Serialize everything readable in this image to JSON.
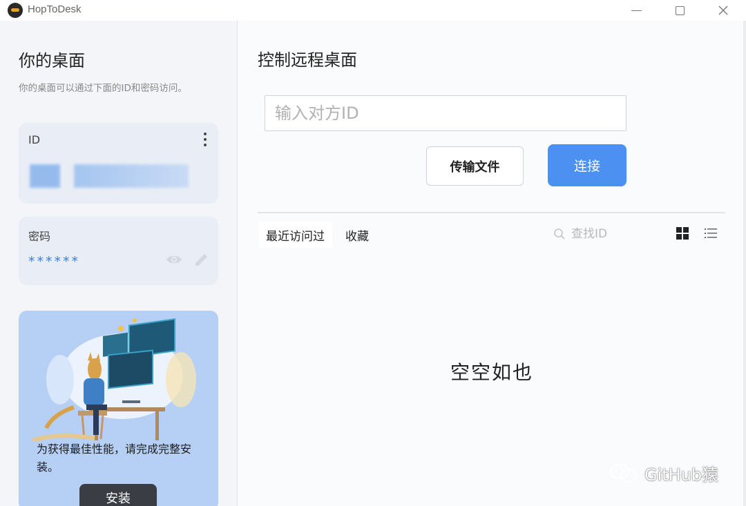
{
  "window": {
    "title": "HopToDesk",
    "minimize": "—",
    "maximize": "□",
    "close": "✕"
  },
  "left": {
    "title": "你的桌面",
    "description": "你的桌面可以通过下面的ID和密码访问。",
    "id_card": {
      "label": "ID"
    },
    "password_card": {
      "label": "密码",
      "value": "******"
    },
    "promo": {
      "text": "为获得最佳性能，请完成完整安装。",
      "install_label": "安装"
    }
  },
  "right": {
    "title": "控制远程桌面",
    "id_input_placeholder": "输入对方ID",
    "transfer_file_label": "传输文件",
    "connect_label": "连接",
    "tabs": [
      {
        "label": "最近访问过"
      },
      {
        "label": "收藏"
      }
    ],
    "search_placeholder": "查找ID",
    "empty_text": "空空如也"
  },
  "watermark": {
    "text": "GitHub猿"
  },
  "colors": {
    "accent": "#4c91f2",
    "panel": "#f3f5f8",
    "card": "#e9eef6",
    "promo": "#b6cff5"
  }
}
